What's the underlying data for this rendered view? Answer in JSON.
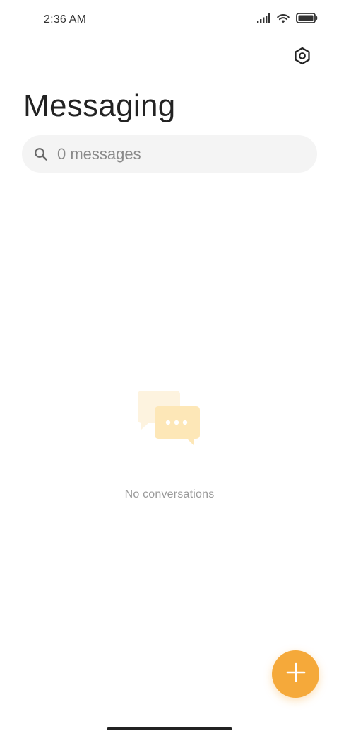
{
  "status_bar": {
    "time": "2:36 AM",
    "icons": [
      "signal-icon",
      "wifi-icon",
      "battery-icon"
    ]
  },
  "header": {
    "title": "Messaging",
    "settings_icon": "settings-hexagon-icon"
  },
  "search": {
    "placeholder": "0 messages",
    "icon": "search-icon"
  },
  "empty_state": {
    "icon": "chat-bubbles-icon",
    "text": "No conversations"
  },
  "fab": {
    "icon": "plus-icon",
    "color": "#f5a93a"
  },
  "colors": {
    "accent": "#f5a93a",
    "empty_icon_light": "#fdf3df",
    "empty_icon_dark": "#fde7b7"
  }
}
